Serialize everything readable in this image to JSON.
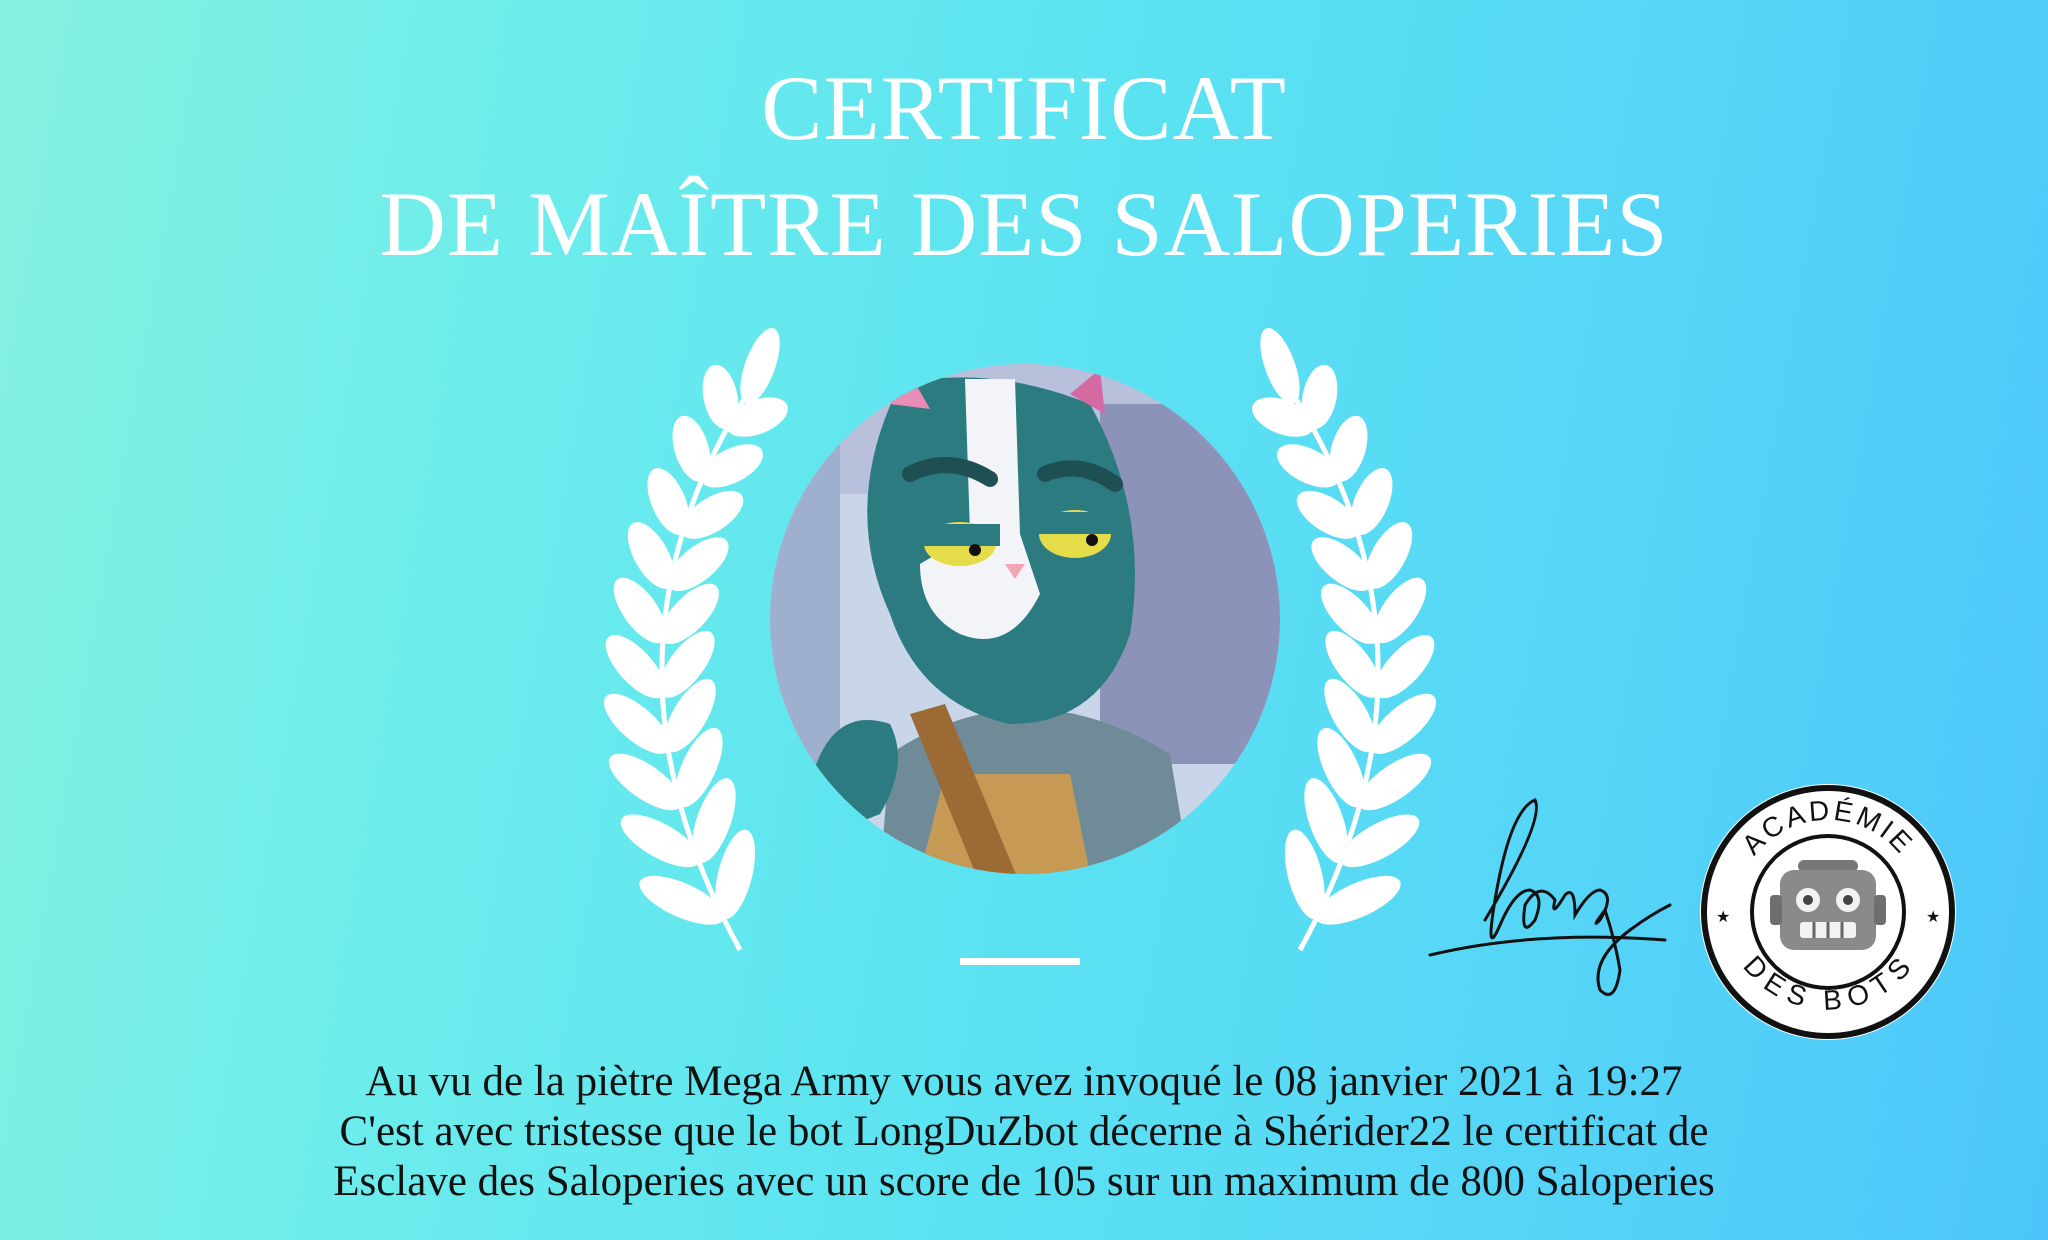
{
  "title": {
    "line1": "CERTIFICAT",
    "line2": "DE MAÎTRE DES SALOPERIES"
  },
  "signature": {
    "text": "long"
  },
  "badge": {
    "top_text": "ACADÉMIE",
    "bottom_text": "DES BOTS"
  },
  "body": {
    "line1": "Au vu de la piètre Mega Army vous avez invoqué le 08 janvier 2021 à 19:27",
    "line2": "C'est avec tristesse que le bot LongDuZbot décerne à Shérider22 le certificat de",
    "line3": "Esclave des Saloperies avec un score de 105 sur un maximum de 800 Saloperies"
  },
  "icons": {
    "laurel": "laurel-wreath-icon",
    "portrait": "cat-character-portrait",
    "robot": "robot-head-icon"
  },
  "colors": {
    "gradient_left": "#86f1df",
    "gradient_right": "#4cc6fa",
    "title": "#ffffff",
    "body_text": "#111111"
  }
}
